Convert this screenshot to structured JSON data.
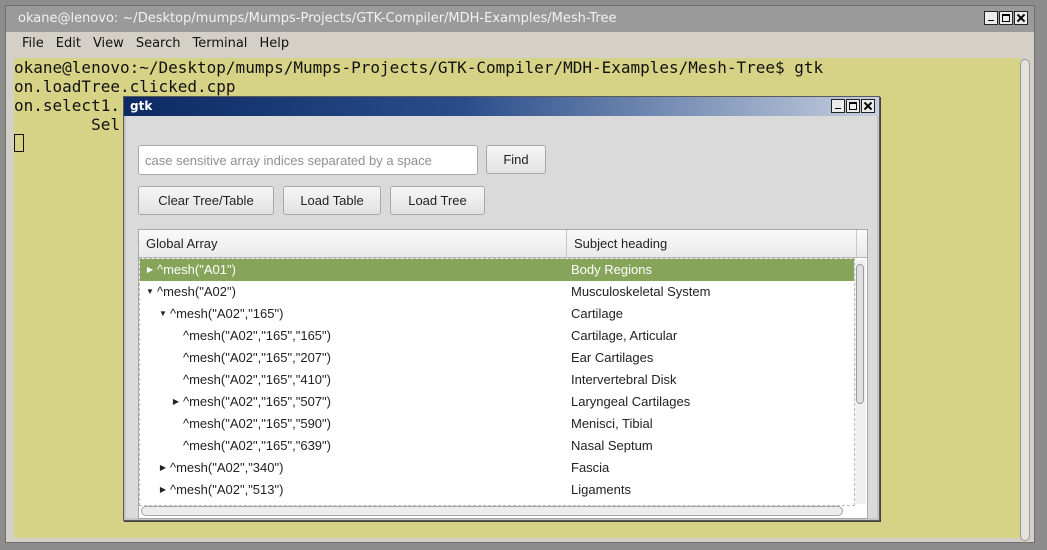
{
  "terminal": {
    "title": "okane@lenovo: ~/Desktop/mumps/Mumps-Projects/GTK-Compiler/MDH-Examples/Mesh-Tree",
    "menu": [
      "File",
      "Edit",
      "View",
      "Search",
      "Terminal",
      "Help"
    ],
    "lines": [
      "okane@lenovo:~/Desktop/mumps/Mumps-Projects/GTK-Compiler/MDH-Examples/Mesh-Tree$ gtk",
      "on.loadTree.clicked.cpp",
      "on.select1.",
      "        Sel"
    ],
    "bg_color": "#d6d387"
  },
  "gtk": {
    "title": "gtk",
    "search_placeholder": "case sensitive array indices separated by a space",
    "search_value": "",
    "find_label": "Find",
    "clear_label": "Clear Tree/Table",
    "load_table_label": "Load Table",
    "load_tree_label": "Load Tree",
    "columns": [
      "Global Array",
      "Subject heading"
    ],
    "selection_color": "#87a45b",
    "rows": [
      {
        "key": "^mesh(\"A01\")",
        "heading": "Body Regions",
        "depth": 0,
        "expander": "collapsed",
        "selected": true
      },
      {
        "key": "^mesh(\"A02\")",
        "heading": "Musculoskeletal System",
        "depth": 0,
        "expander": "expanded",
        "selected": false
      },
      {
        "key": "^mesh(\"A02\",\"165\")",
        "heading": "Cartilage",
        "depth": 1,
        "expander": "expanded",
        "selected": false
      },
      {
        "key": "^mesh(\"A02\",\"165\",\"165\")",
        "heading": "Cartilage, Articular",
        "depth": 2,
        "expander": "none",
        "selected": false
      },
      {
        "key": "^mesh(\"A02\",\"165\",\"207\")",
        "heading": "Ear Cartilages",
        "depth": 2,
        "expander": "none",
        "selected": false
      },
      {
        "key": "^mesh(\"A02\",\"165\",\"410\")",
        "heading": "Intervertebral Disk",
        "depth": 2,
        "expander": "none",
        "selected": false
      },
      {
        "key": "^mesh(\"A02\",\"165\",\"507\")",
        "heading": "Laryngeal Cartilages",
        "depth": 2,
        "expander": "collapsed",
        "selected": false
      },
      {
        "key": "^mesh(\"A02\",\"165\",\"590\")",
        "heading": "Menisci, Tibial",
        "depth": 2,
        "expander": "none",
        "selected": false
      },
      {
        "key": "^mesh(\"A02\",\"165\",\"639\")",
        "heading": "Nasal Septum",
        "depth": 2,
        "expander": "none",
        "selected": false
      },
      {
        "key": "^mesh(\"A02\",\"340\")",
        "heading": "Fascia",
        "depth": 1,
        "expander": "collapsed",
        "selected": false
      },
      {
        "key": "^mesh(\"A02\",\"513\")",
        "heading": "Ligaments",
        "depth": 1,
        "expander": "collapsed",
        "selected": false
      }
    ]
  }
}
